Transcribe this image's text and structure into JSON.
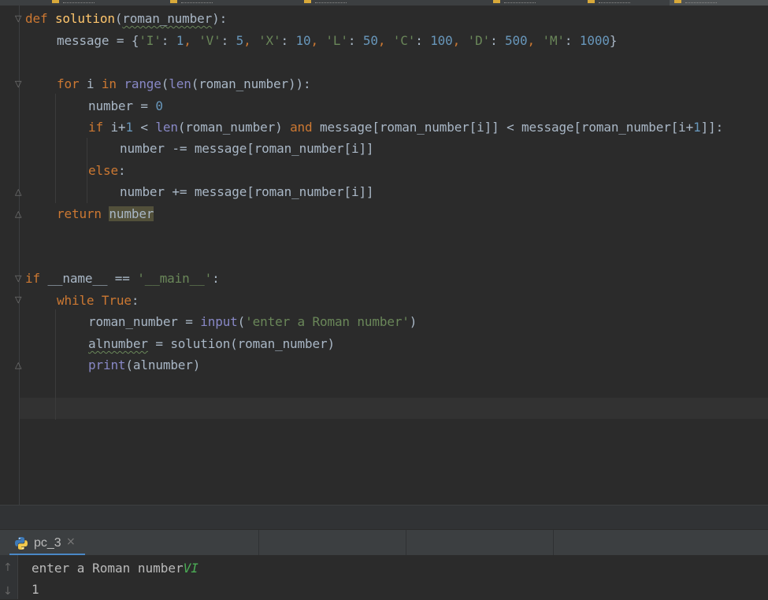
{
  "editor": {
    "lines": {
      "l1": {
        "def": "def",
        "fname": "solution",
        "open": "(",
        "param": "roman_number",
        "close": "):"
      },
      "l2": {
        "lhs": "message = {",
        "pairs": [
          {
            "k": "'I'",
            "v": "1"
          },
          {
            "k": "'V'",
            "v": "5"
          },
          {
            "k": "'X'",
            "v": "10"
          },
          {
            "k": "'L'",
            "v": "50"
          },
          {
            "k": "'C'",
            "v": "100"
          },
          {
            "k": "'D'",
            "v": "500"
          },
          {
            "k": "'M'",
            "v": "1000"
          }
        ],
        "colon": ": ",
        "comma": ", ",
        "end": "}"
      },
      "l4": {
        "for": "for",
        "i": " i ",
        "in": "in",
        "range": "range",
        "p1": "(",
        "len": "len",
        "rest": "(roman_number)):"
      },
      "l5": {
        "text": "number = ",
        "zero": "0"
      },
      "l6": {
        "if": "if",
        "a": " i+",
        "one": "1",
        "b": " < ",
        "len": "len",
        "c": "(roman_number) ",
        "and": "and",
        "d": " message[roman_number[i]] < message[roman_number[i+",
        "one2": "1",
        "e": "]]:"
      },
      "l7": {
        "text": "number -= message[roman_number[i]]"
      },
      "l8": {
        "else": "else",
        "colon": ":"
      },
      "l9": {
        "text": "number += message[roman_number[i]]"
      },
      "l10": {
        "ret": "return",
        "sp": " ",
        "var": "number"
      },
      "l13": {
        "if": "if",
        "a": " __name__ == ",
        "str": "'__main__'",
        "colon": ":"
      },
      "l14": {
        "while": "while",
        "sp": " ",
        "true": "True",
        "colon": ":"
      },
      "l15": {
        "a": "roman_number = ",
        "input": "input",
        "p": "(",
        "str": "'enter a Roman number'",
        "pc": ")"
      },
      "l16": {
        "var": "alnumber",
        "rest": " = solution(roman_number)"
      },
      "l17": {
        "print": "print",
        "rest": "(alnumber)"
      }
    }
  },
  "run_panel": {
    "tab_label": "pc_3",
    "close_glyph": "×",
    "icons": {
      "tab": "python-icon",
      "rerun": "arrow-up-icon",
      "down": "arrow-down-icon"
    },
    "console": {
      "prompt": "enter a Roman number",
      "user_input": "VI",
      "output": "1"
    }
  },
  "colors": {
    "background": "#2b2b2b",
    "keyword": "#cc7832",
    "function": "#ffc66d",
    "string": "#6a8759",
    "number": "#6897bb",
    "builtin": "#8888c6",
    "text": "#a9b7c6",
    "console_input": "#4bad55",
    "run_tab_accent": "#4a88c7"
  }
}
